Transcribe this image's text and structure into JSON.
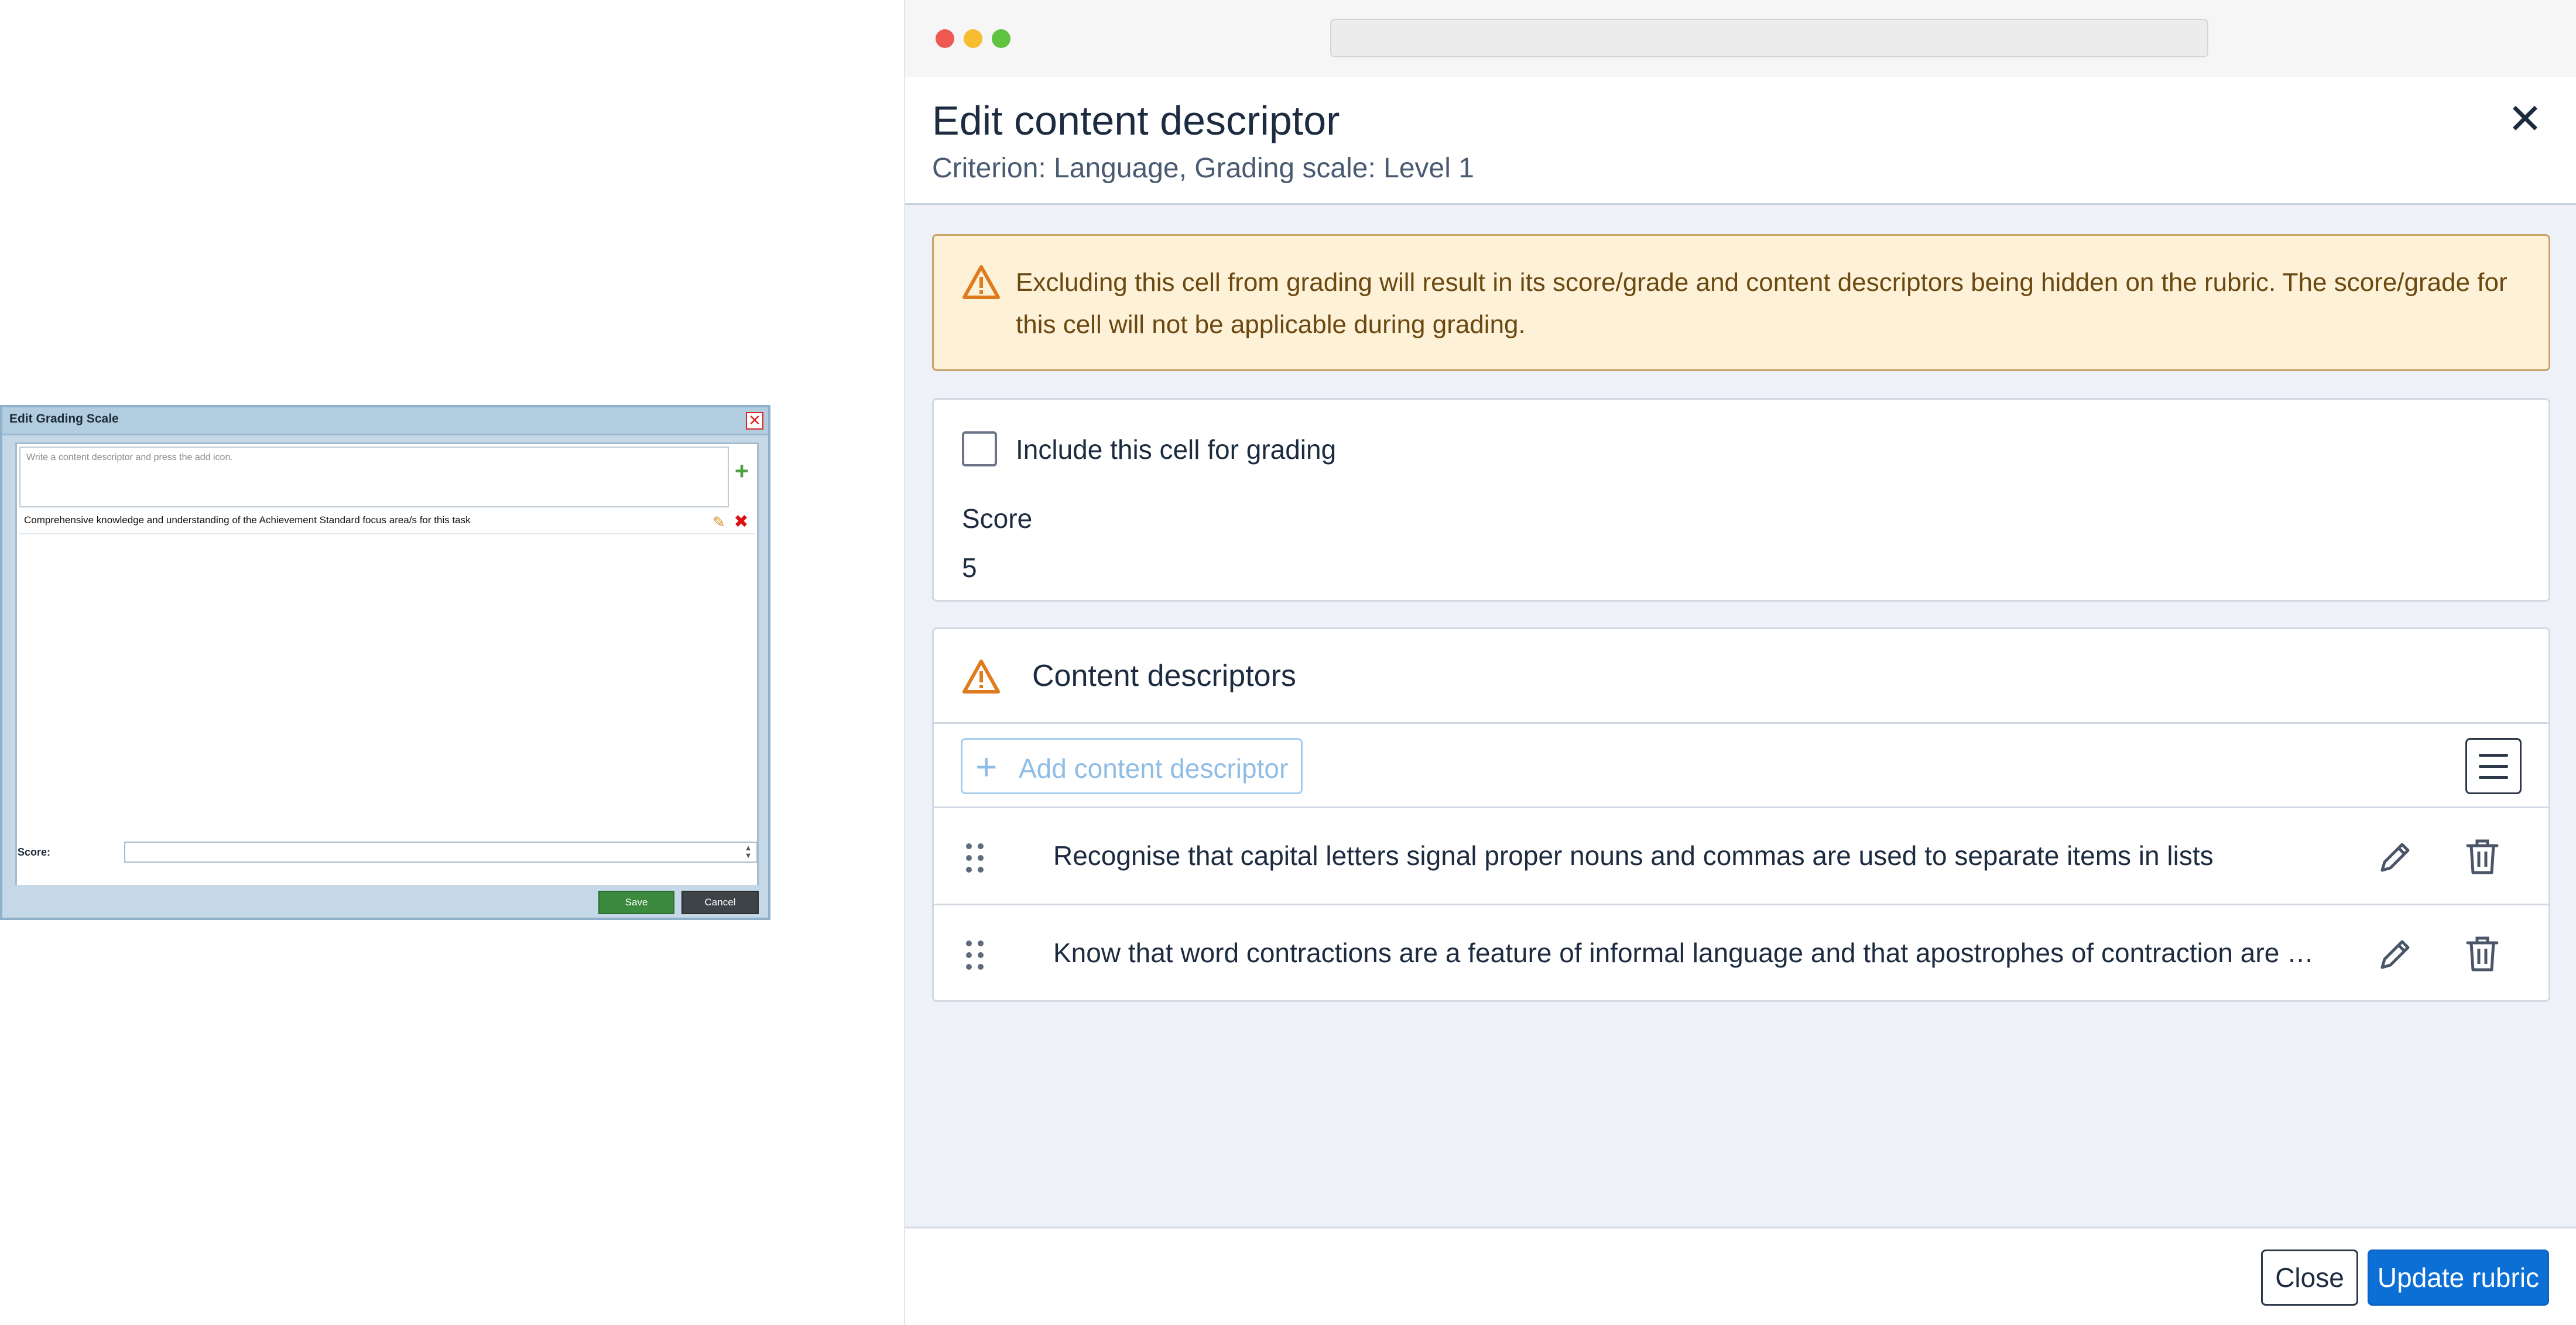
{
  "legacy_dialog": {
    "title": "Edit Grading Scale",
    "close_glyph": "✕",
    "input_placeholder": "Write a content descriptor and press the add icon.",
    "add_glyph": "+",
    "descriptor_text": "Comprehensive knowledge and understanding of the Achievement Standard focus area/s for this task",
    "edit_glyph": "✎",
    "delete_glyph": "✖",
    "score_label": "Score:",
    "spinner_up": "▲",
    "spinner_down": "▼",
    "save_label": "Save",
    "cancel_label": "Cancel"
  },
  "modal": {
    "title": "Edit content descriptor",
    "subtitle": "Criterion: Language, Grading scale: Level 1",
    "close_glyph": "✕",
    "alert": {
      "icon": "warning-triangle-icon",
      "text": "Excluding this cell from grading will result in its score/grade and content descriptors being hidden on the rubric. The score/grade for this cell will not be applicable during grading."
    },
    "grading": {
      "include_label": "Include this cell for grading",
      "include_checked": false,
      "score_label": "Score",
      "score_value": "5"
    },
    "descriptors": {
      "title": "Content descriptors",
      "add_label": "Add content descriptor",
      "add_glyph": "+",
      "items": [
        {
          "text": "Recognise that capital letters signal proper nouns and commas are used to separate items in lists"
        },
        {
          "text": "Know that word contractions are a feature of informal language and that apostrophes of contraction are u..."
        }
      ]
    },
    "footer": {
      "close_label": "Close",
      "update_label": "Update rubric"
    }
  },
  "colors": {
    "primary": "#0b6fd6",
    "warning_bg": "#fdf1d8",
    "warning_icon": "#e07a1f",
    "legacy_save": "#3c8a3e",
    "legacy_cancel": "#3e4348"
  }
}
